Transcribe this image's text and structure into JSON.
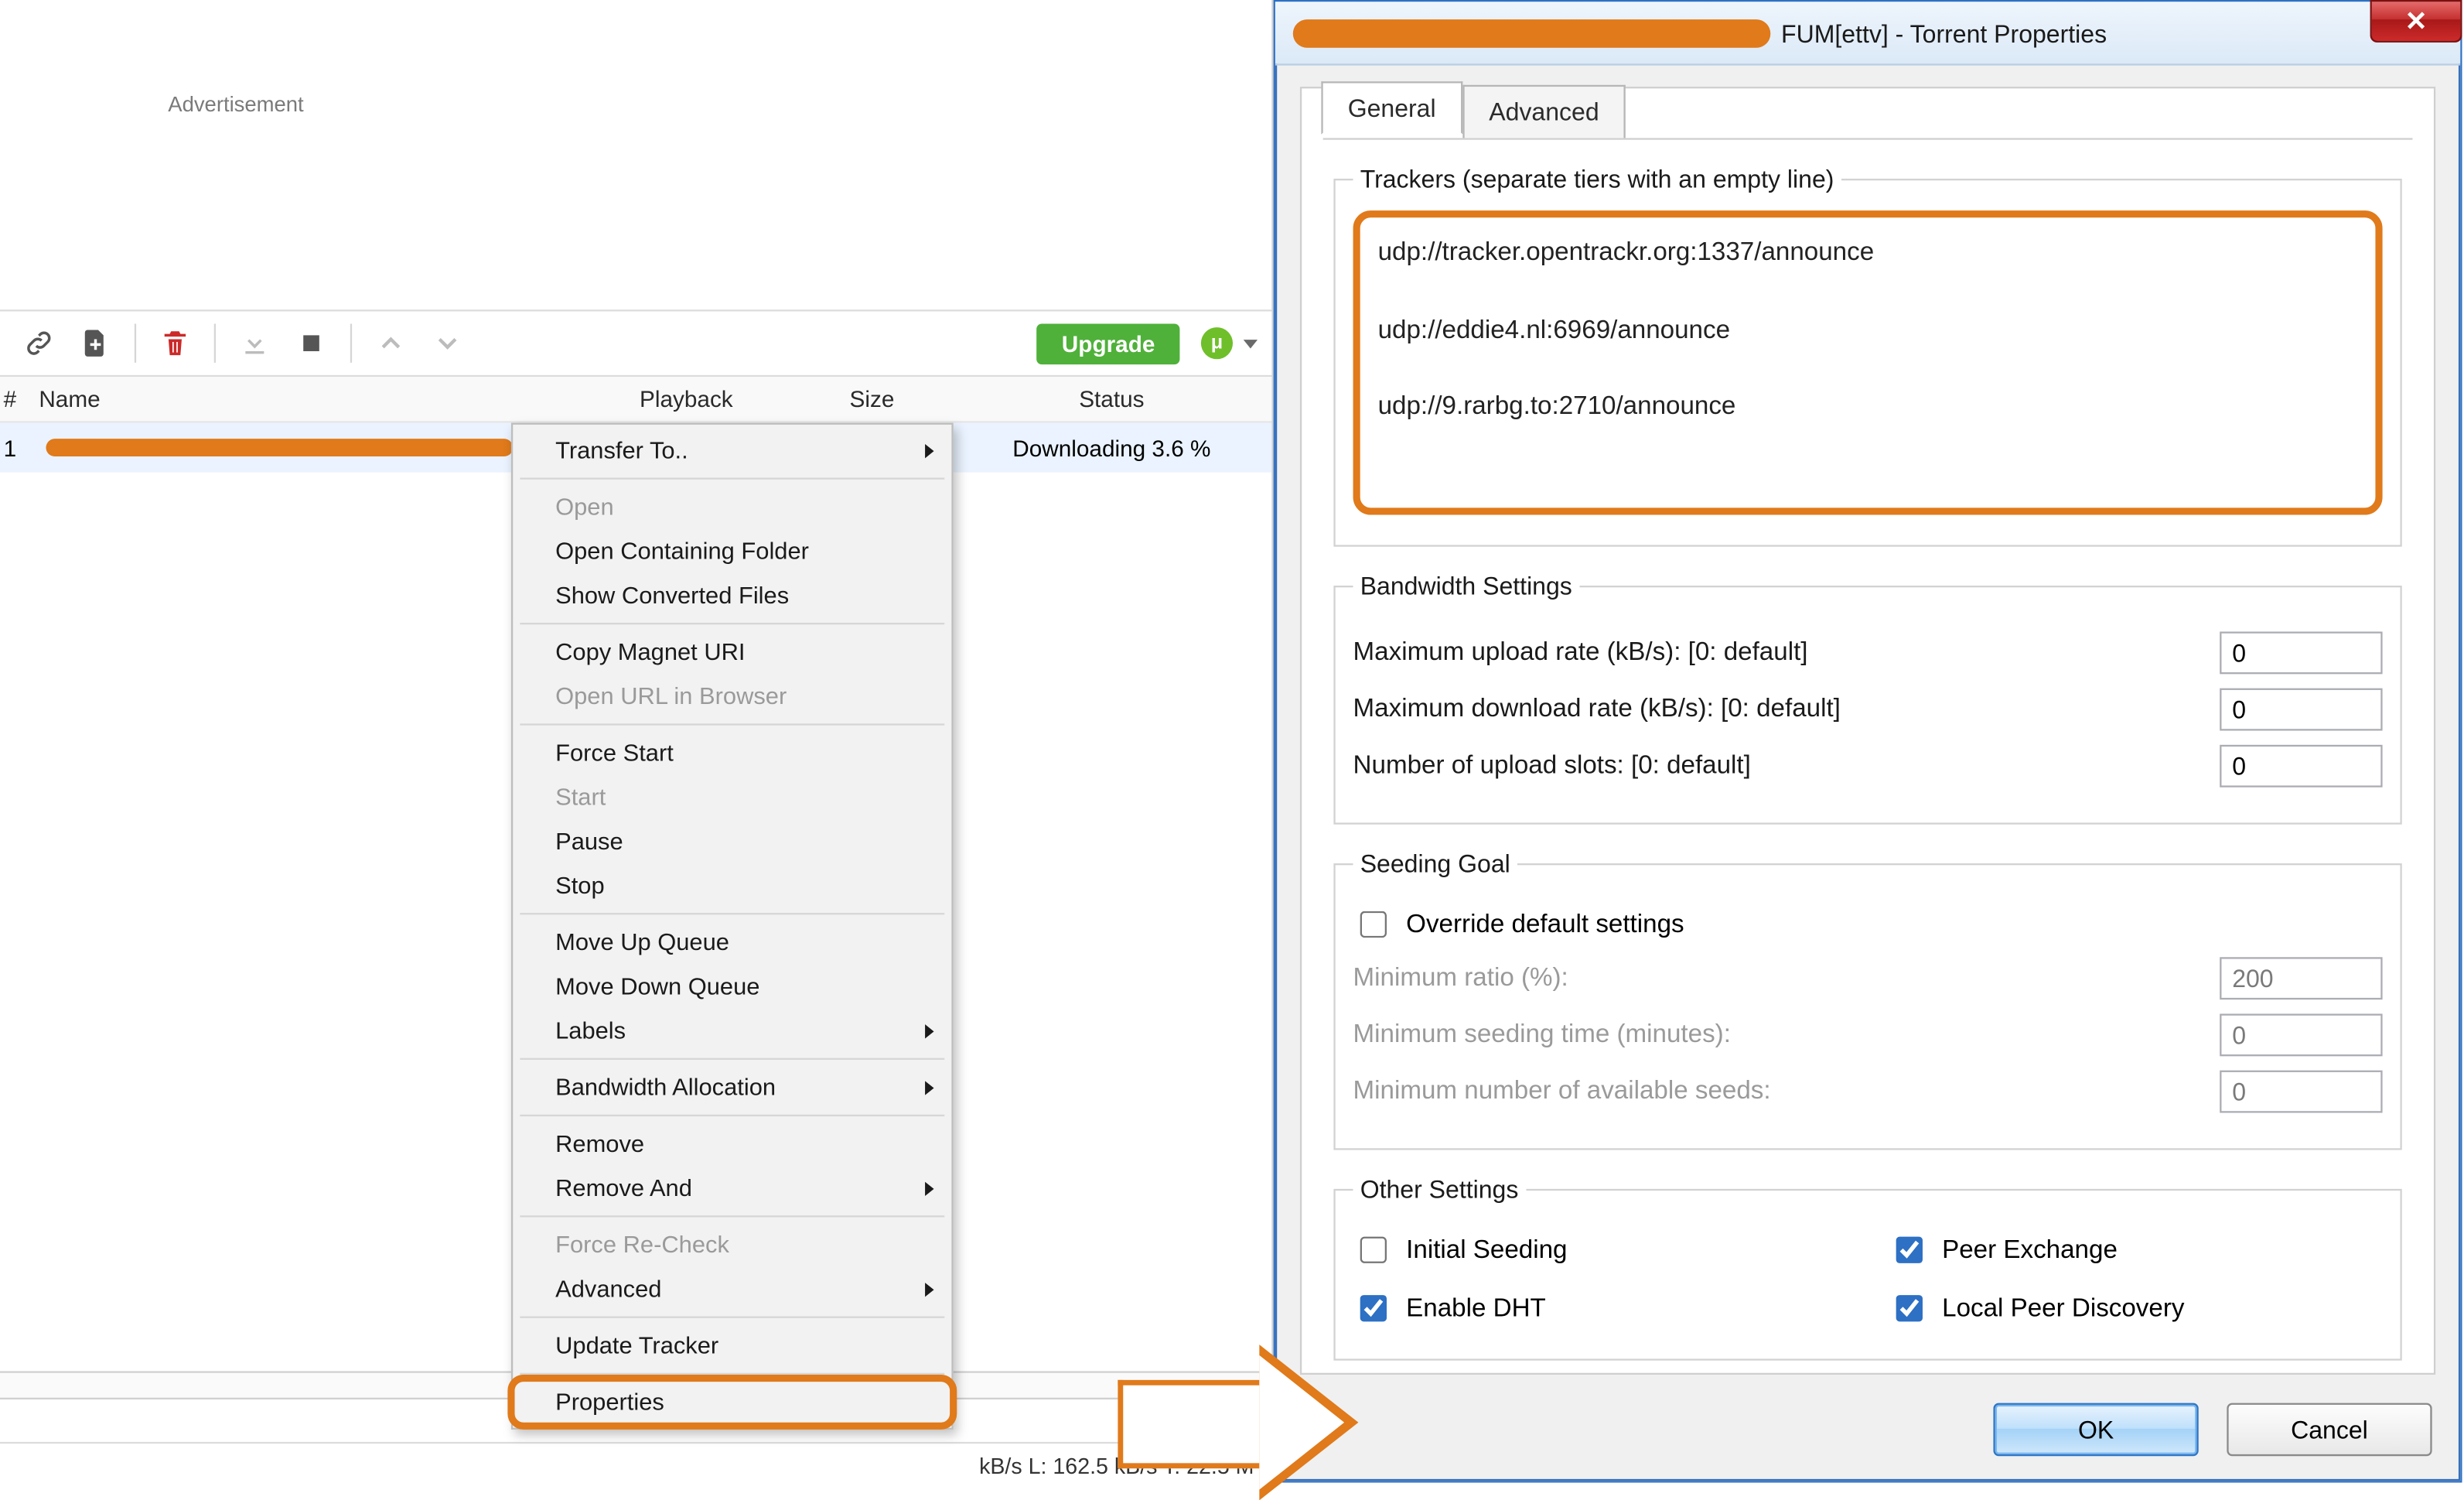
{
  "main": {
    "ad_label": "Advertisement",
    "upgrade_label": "Upgrade",
    "columns": {
      "num": "#",
      "name": "Name",
      "playback": "Playback",
      "size": "Size",
      "status": "Status"
    },
    "row": {
      "index": "1",
      "status": "Downloading 3.6 %"
    },
    "statusbar": "kB/s L: 162.5 kB/s T: 22.5 M"
  },
  "context": {
    "transfer_to": "Transfer To..",
    "open": "Open",
    "open_containing": "Open Containing Folder",
    "show_converted": "Show Converted Files",
    "copy_magnet": "Copy Magnet URI",
    "open_url": "Open URL in Browser",
    "force_start": "Force Start",
    "start": "Start",
    "pause": "Pause",
    "stop": "Stop",
    "move_up": "Move Up Queue",
    "move_down": "Move Down Queue",
    "labels": "Labels",
    "bandwidth": "Bandwidth Allocation",
    "remove": "Remove",
    "remove_and": "Remove And",
    "force_recheck": "Force Re-Check",
    "advanced": "Advanced",
    "update_tracker": "Update Tracker",
    "properties": "Properties"
  },
  "dialog": {
    "title_suffix": "FUM[ettv] - Torrent Properties",
    "tabs": {
      "general": "General",
      "advanced": "Advanced"
    },
    "trackers": {
      "legend": "Trackers (separate tiers with an empty line)",
      "text": "udp://tracker.opentrackr.org:1337/announce\n\nudp://eddie4.nl:6969/announce\n\nudp://9.rarbg.to:2710/announce"
    },
    "bandwidth": {
      "legend": "Bandwidth Settings",
      "up": "Maximum upload rate (kB/s): [0: default]",
      "dn": "Maximum download rate (kB/s): [0: default]",
      "slots": "Number of upload slots: [0: default]",
      "up_val": "0",
      "dn_val": "0",
      "slots_val": "0"
    },
    "seeding": {
      "legend": "Seeding Goal",
      "override": "Override default settings",
      "ratio": "Minimum ratio (%):",
      "time": "Minimum seeding time (minutes):",
      "seeds": "Minimum number of available seeds:",
      "ratio_val": "200",
      "time_val": "0",
      "seeds_val": "0",
      "override_checked": false
    },
    "other": {
      "legend": "Other Settings",
      "initial": "Initial Seeding",
      "dht": "Enable DHT",
      "pex": "Peer Exchange",
      "lpd": "Local Peer Discovery",
      "initial_checked": false,
      "dht_checked": true,
      "pex_checked": true,
      "lpd_checked": true
    },
    "buttons": {
      "ok": "OK",
      "cancel": "Cancel"
    }
  }
}
